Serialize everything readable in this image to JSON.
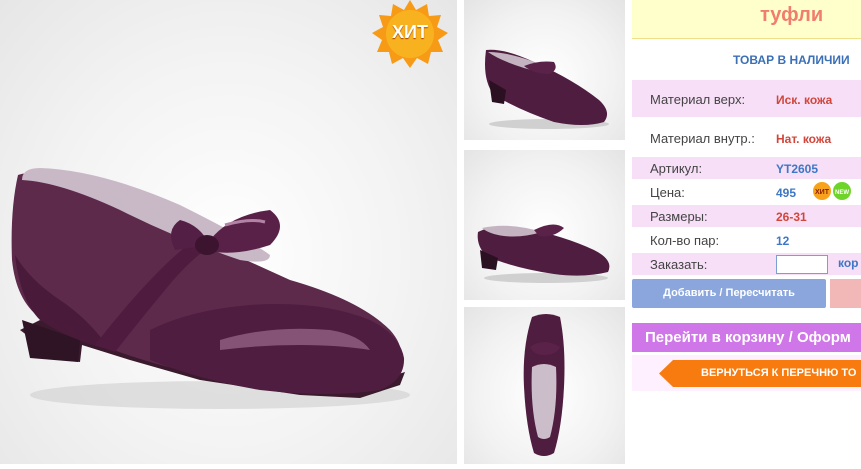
{
  "product": {
    "title": "туфли",
    "stock_status": "ТОВАР В НАЛИЧИИ",
    "hit_badge": "ХИТ"
  },
  "specs": [
    {
      "label": "Материал верх:",
      "value": "Иск. кожа"
    },
    {
      "label": "Материал внутр.:",
      "value": "Нат. кожа"
    },
    {
      "label": "Артикул:",
      "value": "YT2605"
    },
    {
      "label": "Цена:",
      "value": "495"
    },
    {
      "label": "Размеры:",
      "value": "26-31"
    },
    {
      "label": "Кол-во пар:",
      "value": "12"
    },
    {
      "label": "Заказать:",
      "value": "кор"
    }
  ],
  "mini_badges": {
    "hit": "ХИТ",
    "new": "NEW"
  },
  "order_input": {
    "value": ""
  },
  "buttons": {
    "add": "Добавить / Пересчитать",
    "cart": "Перейти в корзину / Оформ",
    "back": "ВЕРНУТЬСЯ К ПЕРЕЧНЮ ТО"
  },
  "colors": {
    "accent_purple": "#cf76e8",
    "button_blue": "#8aa6dc",
    "back_orange": "#f77b0f",
    "title_bg": "#ffffcc"
  }
}
